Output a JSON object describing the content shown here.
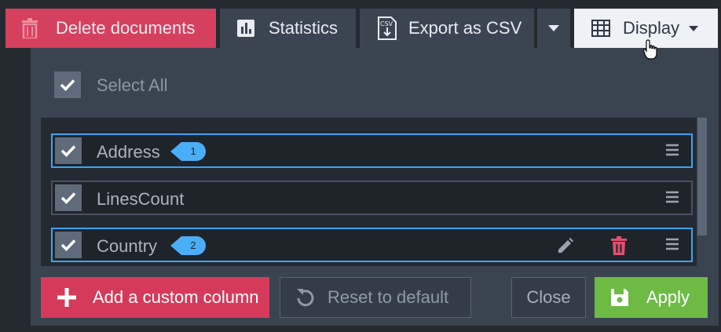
{
  "toolbar": {
    "delete_label": "Delete documents",
    "statistics_label": "Statistics",
    "export_label": "Export as CSV",
    "export_icon_text": "CSV",
    "display_label": "Display"
  },
  "panel": {
    "select_all_label": "Select All",
    "select_all_checked": true,
    "columns": [
      {
        "label": "Address",
        "checked": true,
        "highlighted": true,
        "badge": "1",
        "editable": false
      },
      {
        "label": "LinesCount",
        "checked": true,
        "highlighted": false,
        "badge": null,
        "editable": false
      },
      {
        "label": "Country",
        "checked": true,
        "highlighted": true,
        "badge": "2",
        "editable": true
      }
    ],
    "add_column_label": "Add a custom column",
    "reset_label": "Reset to default",
    "close_label": "Close",
    "apply_label": "Apply"
  },
  "colors": {
    "danger": "#d5405e",
    "success": "#6dbb45",
    "highlight_border": "#39a4f4",
    "badge": "#4aaef6"
  }
}
